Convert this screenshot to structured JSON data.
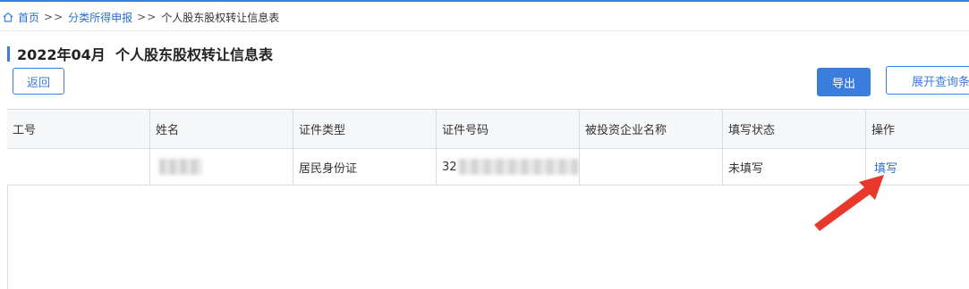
{
  "breadcrumb": {
    "home": "首页",
    "sep1": ">>",
    "category": "分类所得申报",
    "sep2": ">>",
    "current": "个人股东股权转让信息表"
  },
  "page_title": "2022年04月  个人股东股权转让信息表",
  "toolbar": {
    "back_label": "返回",
    "export_label": "导出",
    "expand_query_label": "展开查询条件"
  },
  "table": {
    "columns": [
      "工号",
      "姓名",
      "证件类型",
      "证件号码",
      "被投资企业名称",
      "填写状态",
      "操作"
    ],
    "rows": [
      {
        "employee_id": "",
        "name": "[redacted]",
        "id_type": "居民身份证",
        "id_number_prefix": "32",
        "invested_company": "",
        "fill_status": "未填写",
        "action": "填写"
      }
    ]
  },
  "colors": {
    "accent": "#3b7ddd",
    "link": "#2a6fc9",
    "annotation_arrow": "#e8382b"
  },
  "icons": {
    "home": "home-icon",
    "annotation": "red-arrow-icon"
  }
}
